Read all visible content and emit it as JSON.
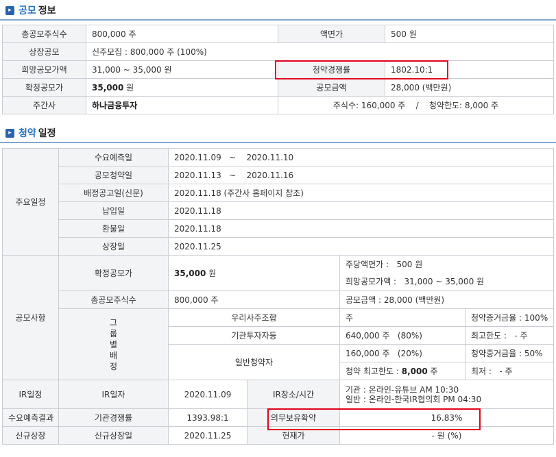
{
  "offering": {
    "title_hl": "공모",
    "title_rest": "정보",
    "rows": {
      "total_shares_label": "총공모주식수",
      "total_shares_value": "800,000 주",
      "face_value_label": "액면가",
      "face_value_value": "500 원",
      "listing_type_label": "상장공모",
      "listing_type_value": "신주모집 : 800,000 주 (100%)",
      "hope_price_label": "희망공모가액",
      "hope_price_value": "31,000 ~ 35,000 원",
      "competition_label": "청약경쟁률",
      "competition_value": "1802.10:1",
      "final_price_label": "확정공모가",
      "final_price_value": "35,000",
      "final_price_unit": " 원",
      "amount_label": "공모금액",
      "amount_value": "28,000 (백만원)",
      "underwriter_label": "주간사",
      "underwriter_value": "하나금융투자",
      "underwriter_info": "주식수: 160,000 주    /    청약한도: 8,000 주"
    }
  },
  "subscription": {
    "title_hl": "청약",
    "title_rest": "일정",
    "main_schedule_label": "주요일정",
    "schedule": [
      {
        "label": "수요예측일",
        "value": "2020.11.09   ~    2020.11.10"
      },
      {
        "label": "공모청약일",
        "value": "2020.11.13   ~    2020.11.16"
      },
      {
        "label": "배정공고일(신문)",
        "value": "2020.11.18 (주간사 홈페이지 참조)"
      },
      {
        "label": "납입일",
        "value": "2020.11.18"
      },
      {
        "label": "환불일",
        "value": "2020.11.18"
      },
      {
        "label": "상장일",
        "value": "2020.11.25"
      }
    ],
    "offer_label": "공모사항",
    "confirmed_price_label": "확정공모가",
    "confirmed_price_value": "35,000",
    "confirmed_price_unit": " 원",
    "par_value": "주당액면가 :   500 원",
    "hope_price": "희망공모가액 :   31,000 ~ 35,000 원",
    "total_shares_label": "총공모주식수",
    "total_shares_value": "800,000 주",
    "amount_value": "공모금액 : 28,000 (백만원)",
    "group_label": "그\n룹\n별\n배\n정",
    "groups": {
      "employee_label": "우리사주조합",
      "employee_shares": "주",
      "employee_deposit": "청약증거금율 : 100%",
      "inst_label": "기관투자자등",
      "inst_shares": "640,000 주   (80%)",
      "inst_max": "최고한도 :   - 주",
      "general_label": "일반청약자",
      "general_shares": "160,000 주   (20%)",
      "general_deposit": "청약증거금율 : 50%",
      "general_limit_prefix": "청약 최고한도 : ",
      "general_limit_value": "8,000",
      "general_limit_unit": " 주",
      "general_min": "최저 :   - 주"
    },
    "ir_label": "IR일정",
    "ir_date_label": "IR일자",
    "ir_date_value": "2020.11.09",
    "ir_place_label": "IR장소/시간",
    "ir_place_line1": "기관 : 온라인-유튜브 AM 10:30",
    "ir_place_line2": "일반 : 온라인-한국IR협의회 PM 04:30",
    "demand_label": "수요예측결과",
    "inst_competition_label": "기관경쟁률",
    "inst_competition_value": "1393.98:1",
    "lockup_label": "의무보유확약",
    "lockup_value": "16.83%",
    "new_listing_label": "신규상장",
    "new_listing_date_label": "신규상장일",
    "new_listing_date_value": "2020.11.25",
    "current_price_label": "현재가",
    "current_price_value": "- 원 (%)"
  }
}
